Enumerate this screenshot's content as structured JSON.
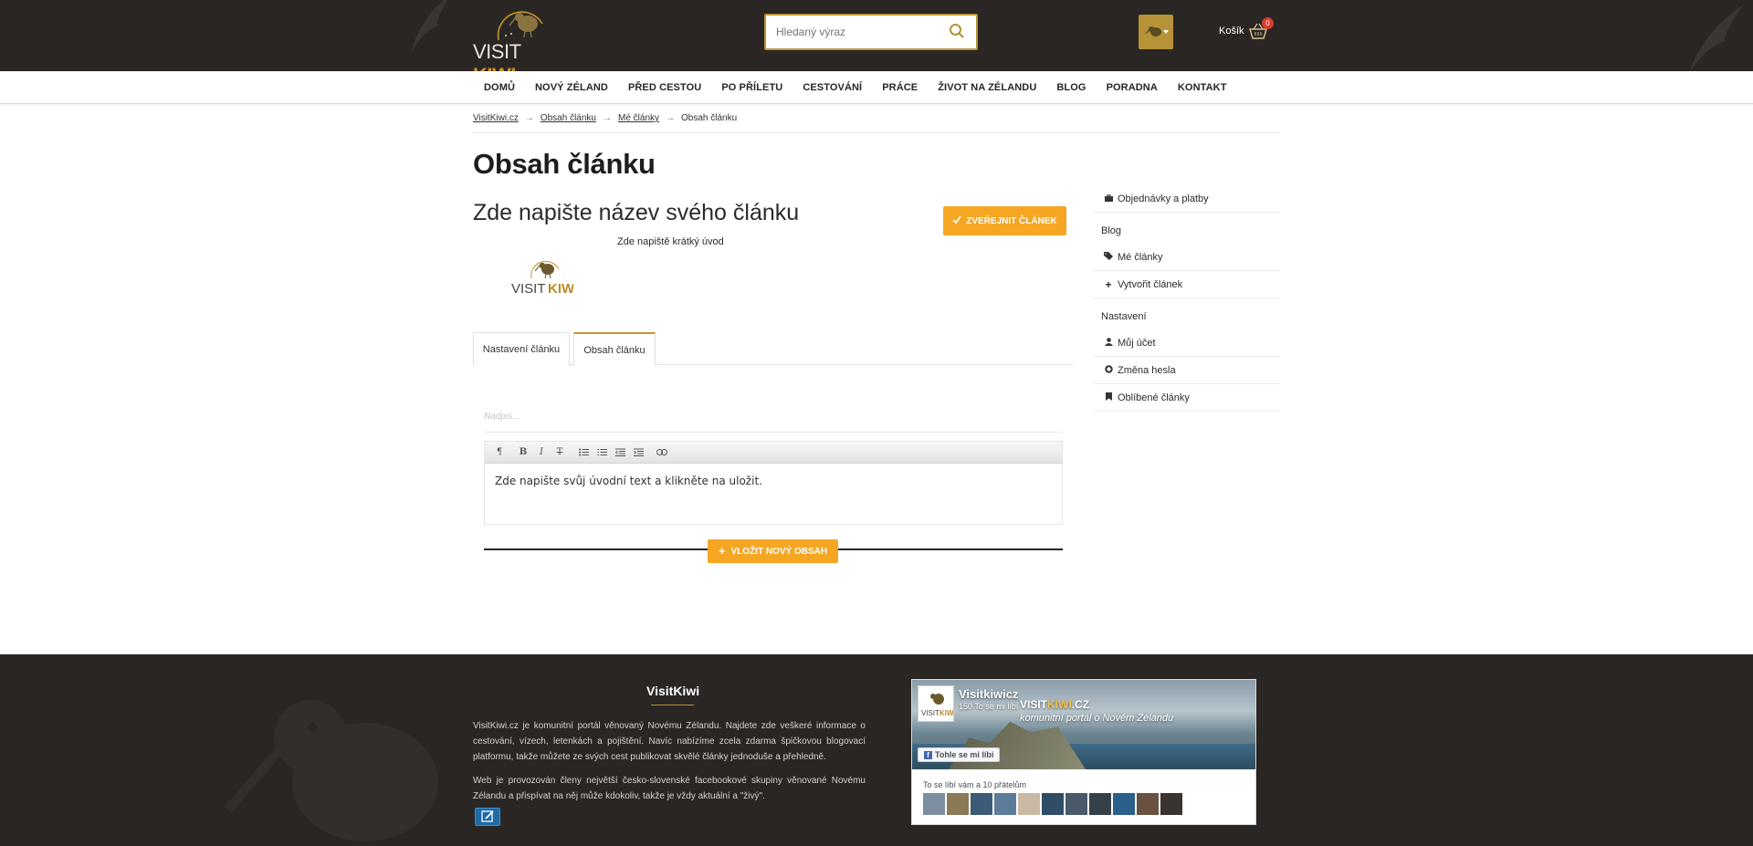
{
  "header": {
    "logo_text_a": "VISIT",
    "logo_text_b": "KIWI",
    "search_placeholder": "Hledaný výraz",
    "cart_label": "Košík",
    "cart_count": "0"
  },
  "nav": {
    "items": [
      "DOMŮ",
      "NOVÝ ZÉLAND",
      "PŘED CESTOU",
      "PO PŘÍLETU",
      "CESTOVÁNÍ",
      "PRÁCE",
      "ŽIVOT NA ZÉLANDU",
      "BLOG",
      "PORADNA",
      "KONTAKT"
    ]
  },
  "breadcrumb": {
    "items": [
      "VisitKiwi.cz",
      "Obsah článku",
      "Mé články",
      "Obsah článku"
    ],
    "separator": "→"
  },
  "main": {
    "page_title": "Obsah článku",
    "article_name": "Zde napište název svého článku",
    "article_intro": "Zde napiště krátký úvod",
    "publish_label": "ZVEŘEJNIT ČLÁNEK",
    "tabs": [
      "Nastavení článku",
      "Obsah článku"
    ],
    "active_tab": "Obsah článku",
    "heading_placeholder": "Nadpis...",
    "editor_text": "Zde napište svůj úvodní text a klikněte na uložit.",
    "add_content_label": "VLOŽIT NOVÝ OBSAH"
  },
  "sidebar": {
    "orders": "Objednávky a platby",
    "section_blog": "Blog",
    "my_articles": "Mé články",
    "create_article": "Vytvořit článek",
    "section_settings": "Nastavení",
    "my_account": "Můj účet",
    "change_password": "Změna hesla",
    "favourite_articles": "Oblíbené články"
  },
  "footer": {
    "title": "VisitKiwi",
    "paragraph1": "VisitKiwi.cz je komunitní portál věnovaný Novému Zélandu. Najdete zde veškeré informace o cestování, vízech, letenkách a pojištění. Navíc nabízíme zcela zdarma špičkovou blogovací platformu, takže můžete ze svých cest publikovat skvělé články jednoduše a přehledně.",
    "paragraph2": "Web je provozován členy největší česko-slovenské facebookové skupiny věnované Novému Zélandu a přispívat na něj může kdokoliv, takže je vždy aktuální a \"živý\".",
    "fb": {
      "page_name": "Visitkiwicz",
      "likes": "150 To se mi líbí",
      "brand_a": "VISIT",
      "brand_b": "KIWI",
      "brand_c": ".CZ",
      "tagline": "komunitní portál o Novém Zélandu",
      "like_button": "Tohle se mi líbí",
      "friends_text": "To se líbí vám a 10 přátelům"
    }
  },
  "colors": {
    "header_bg": "#2a2624",
    "accent_gold": "#b79337",
    "button_orange": "#f5a623",
    "cart_badge": "#d93a2b"
  }
}
